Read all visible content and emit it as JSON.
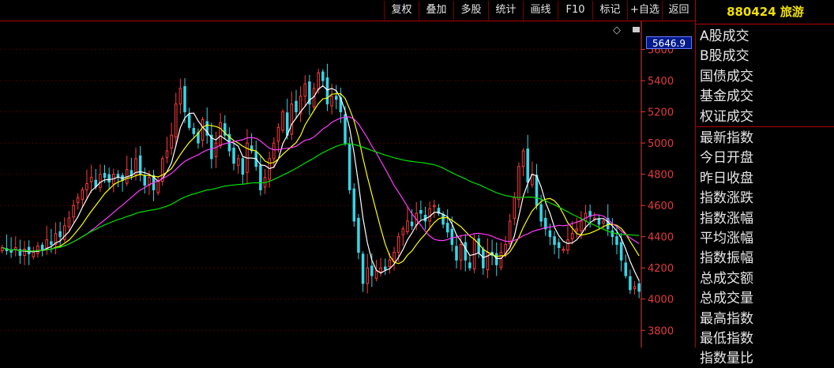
{
  "toolbar": {
    "buttons": [
      "复权",
      "叠加",
      "多股",
      "统计",
      "画线",
      "F10",
      "标记",
      "+自选",
      "返回"
    ]
  },
  "stock": {
    "code": "880424",
    "name": "旅游"
  },
  "current_price_label": "5646.9",
  "right_panel": {
    "trade_items": [
      "A股成交",
      "B股成交",
      "国债成交",
      "基金成交",
      "权证成交"
    ],
    "index_items": [
      "最新指数",
      "今日开盘",
      "昨日收盘",
      "指数涨跌",
      "指数涨幅",
      "平均涨幅",
      "指数振幅",
      "总成交额",
      "总成交量",
      "最高指数",
      "最低指数",
      "指数量比"
    ]
  },
  "icons": {
    "diamond": "◇",
    "square": "square-icon"
  },
  "colors": {
    "background": "#000000",
    "up_candle": "#ff3b3b",
    "down_candle": "#37d5e6",
    "ma5": "#ffffff",
    "ma10": "#ffff00",
    "ma20": "#ff3bff",
    "ma60": "#00e000",
    "axis": "#e23b3b",
    "title": "#f0e000"
  },
  "chart_data": {
    "type": "candlestick",
    "y_ticks": [
      3800,
      4000,
      4200,
      4400,
      4600,
      4800,
      5000,
      5200,
      5400,
      5600
    ],
    "ylim": [
      3690,
      5780
    ],
    "grid": true,
    "close": [
      4330,
      4310,
      4300,
      4330,
      4280,
      4320,
      4290,
      4300,
      4340,
      4310,
      4380,
      4350,
      4420,
      4400,
      4470,
      4520,
      4600,
      4650,
      4700,
      4740,
      4780,
      4720,
      4800,
      4780,
      4750,
      4800,
      4780,
      4760,
      4830,
      4790,
      4900,
      4800,
      4730,
      4780,
      4700,
      4760,
      4900,
      4950,
      5050,
      5250,
      5350,
      5200,
      5100,
      5060,
      5000,
      5150,
      5050,
      4900,
      5000,
      5130,
      5050,
      4950,
      4870,
      4900,
      4800,
      5000,
      4950,
      4850,
      4700,
      4780,
      4900,
      5000,
      5100,
      5200,
      5050,
      5250,
      5200,
      5300,
      5380,
      5250,
      5350,
      5450,
      5400,
      5250,
      5300,
      5280,
      5200,
      5000,
      4700,
      4500,
      4300,
      4100,
      4200,
      4150,
      4180,
      4200,
      4190,
      4250,
      4300,
      4400,
      4450,
      4500,
      4470,
      4550,
      4550,
      4500,
      4580,
      4600,
      4550,
      4480,
      4430,
      4350,
      4250,
      4350,
      4250,
      4200,
      4380,
      4300,
      4200,
      4300,
      4280,
      4220,
      4300,
      4350,
      4500,
      4650,
      4850,
      4950,
      4750,
      4800,
      4600,
      4500,
      4450,
      4400,
      4350,
      4330,
      4320,
      4380,
      4420,
      4450,
      4500,
      4550,
      4530,
      4520,
      4480,
      4500,
      4450,
      4400,
      4350,
      4250,
      4150,
      4060,
      4080,
      4050
    ]
  }
}
